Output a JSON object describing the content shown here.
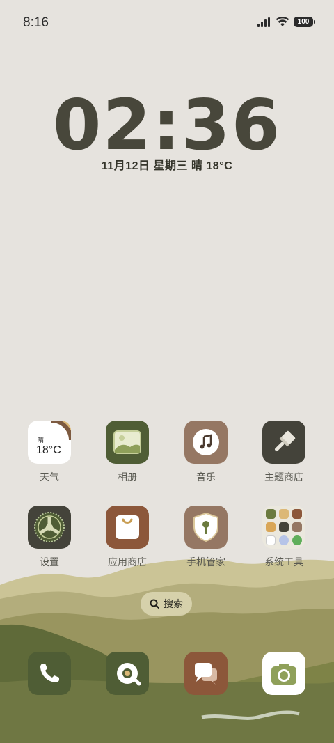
{
  "status_bar": {
    "time": "8:16",
    "battery": "100"
  },
  "clock": {
    "time": "02:36",
    "date": "11月12日  星期三  晴  18°C"
  },
  "apps": [
    {
      "label": "天气",
      "weather_condition": "晴",
      "weather_temp": "18°C"
    },
    {
      "label": "相册"
    },
    {
      "label": "音乐"
    },
    {
      "label": "主题商店"
    },
    {
      "label": "设置"
    },
    {
      "label": "应用商店"
    },
    {
      "label": "手机管家"
    },
    {
      "label": "系统工具"
    }
  ],
  "search": {
    "label": "搜索"
  },
  "dock": [
    {
      "name": "phone"
    },
    {
      "name": "browser"
    },
    {
      "name": "messages"
    },
    {
      "name": "camera"
    }
  ],
  "colors": {
    "dark_green": "#4f5d35",
    "brown": "#8c573a",
    "tan": "#957763",
    "charcoal": "#44433a",
    "background": "#e6e3de"
  }
}
